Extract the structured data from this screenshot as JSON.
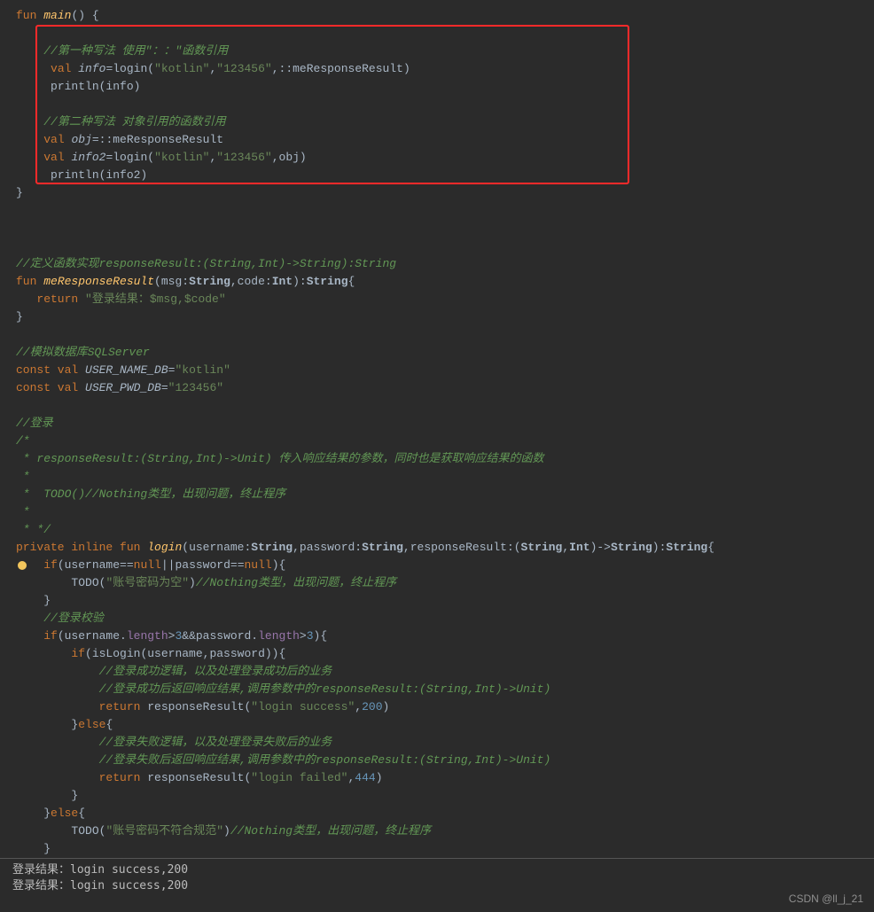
{
  "code": {
    "l1_kw1": "fun",
    "l1_fn": "main",
    "l1_rest": "() {",
    "l2_c": "//第一种写法 使用\"：：\"函数引用",
    "l3_kw": "val",
    "l3_var": "info",
    "l3_eq": "=login(",
    "l3_s1": "\"kotlin\"",
    "l3_c1": ",",
    "l3_s2": "\"123456\"",
    "l3_c2": ",::meResponseResult)",
    "l4": "println(info)",
    "l5_c": "//第二种写法 对象引用的函数引用",
    "l6_kw": "val",
    "l6_var": "obj",
    "l6_rest": "=::meResponseResult",
    "l7_kw": "val",
    "l7_var": "info2",
    "l7_eq": "=login(",
    "l7_s1": "\"kotlin\"",
    "l7_c1": ",",
    "l7_s2": "\"123456\"",
    "l7_c2": ",obj)",
    "l8": "println(info2)",
    "l9": "}",
    "d1": "//定义函数实现responseResult:(String,Int)->String):String",
    "d2_kw": "fun",
    "d2_fn": "meResponseResult",
    "d2_p1": "(msg:",
    "d2_t1": "String",
    "d2_c1": ",code:",
    "d2_t2": "Int",
    "d2_p2": "):",
    "d2_t3": "String",
    "d2_b": "{",
    "d3_kw": "return",
    "d3_s": "\"登录结果：$msg,$code\"",
    "d4": "}",
    "db1": "//模拟数据库SQLServer",
    "db2_kw": "const val",
    "db2_var": "USER_NAME_DB",
    "db2_eq": "=",
    "db2_s": "\"kotlin\"",
    "db3_kw": "const val",
    "db3_var": "USER_PWD_DB",
    "db3_eq": "=",
    "db3_s": "\"123456\"",
    "lg1": "//登录",
    "lg2": "/*",
    "lg3": " * responseResult:(String,Int)->Unit) 传入响应结果的参数，同时也是获取响应结果的函数",
    "lg4": " *",
    "lg5": " *  TODO()//Nothing类型，出现问题，终止程序",
    "lg6": " *",
    "lg7": " * */",
    "f1_kw": "private inline fun",
    "f1_fn": "login",
    "f1_p": "(username:",
    "f1_t1": "String",
    "f1_c1": ",password:",
    "f1_t2": "String",
    "f1_c2": ",responseResult:(",
    "f1_t3": "String",
    "f1_c3": ",",
    "f1_t4": "Int",
    "f1_c4": ")->",
    "f1_t5": "String",
    "f1_c5": "):",
    "f1_t6": "String",
    "f1_b": "{",
    "f2_kw": "if",
    "f2_p": "(username==",
    "f2_n1": "null",
    "f2_or": "||password==",
    "f2_n2": "null",
    "f2_e": "){",
    "f3_fn": "TODO(",
    "f3_s": "\"账号密码为空\"",
    "f3_e": ")",
    "f3_c": "//Nothing类型，出现问题，终止程序",
    "f4": "}",
    "f5": "//登录校验",
    "f6_kw": "if",
    "f6_p": "(username.",
    "f6_len1": "length",
    "f6_gt1": ">",
    "f6_n1": "3",
    "f6_and": "&&password.",
    "f6_len2": "length",
    "f6_gt2": ">",
    "f6_n2": "3",
    "f6_e": "){",
    "f7_kw": "if",
    "f7_p": "(isLogin(username,password)){",
    "f8": "//登录成功逻辑，以及处理登录成功后的业务",
    "f9": "//登录成功后返回响应结果,调用参数中的responseResult:(String,Int)->Unit)",
    "f10_kw": "return",
    "f10_fn": " responseResult(",
    "f10_s": "\"login success\"",
    "f10_c": ",",
    "f10_n": "200",
    "f10_e": ")",
    "f11": "}",
    "f11_kw": "else",
    "f11_b": "{",
    "f12": "//登录失败逻辑，以及处理登录失败后的业务",
    "f13": "//登录失败后返回响应结果,调用参数中的responseResult:(String,Int)->Unit)",
    "f14_kw": "return",
    "f14_fn": " responseResult(",
    "f14_s": "\"login failed\"",
    "f14_c": ",",
    "f14_n": "444",
    "f14_e": ")",
    "f15": "}",
    "f16": "}",
    "f16_kw": "else",
    "f16_b": "{",
    "f17_fn": "TODO(",
    "f17_s": "\"账号密码不符合规范\"",
    "f17_e": ")",
    "f17_c": "//Nothing类型，出现问题，终止程序",
    "f18": "}"
  },
  "console": {
    "l1": "登录结果：login success,200",
    "l2": "登录结果：login success,200"
  },
  "watermark": "CSDN @ll_j_21"
}
